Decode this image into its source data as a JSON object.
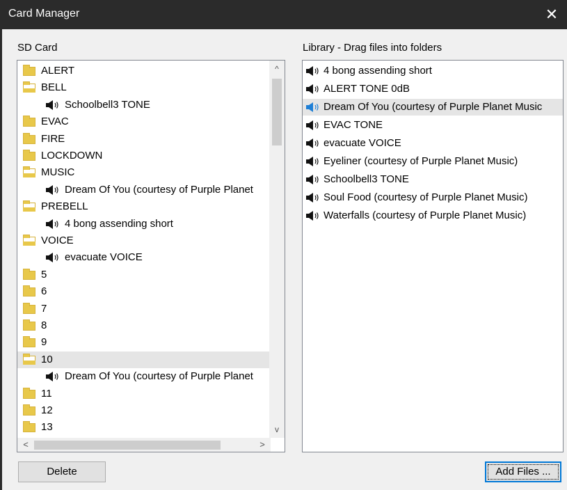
{
  "window": {
    "title": "Card Manager",
    "close_glyph": "✕"
  },
  "sd_card": {
    "label": "SD Card",
    "items": [
      {
        "type": "folder",
        "open": false,
        "label": "ALERT"
      },
      {
        "type": "folder",
        "open": true,
        "label": "BELL"
      },
      {
        "type": "file",
        "label": "Schoolbell3 TONE"
      },
      {
        "type": "folder",
        "open": false,
        "label": "EVAC"
      },
      {
        "type": "folder",
        "open": false,
        "label": "FIRE"
      },
      {
        "type": "folder",
        "open": false,
        "label": "LOCKDOWN"
      },
      {
        "type": "folder",
        "open": true,
        "label": "MUSIC"
      },
      {
        "type": "file",
        "label": "Dream Of You (courtesy of Purple Planet"
      },
      {
        "type": "folder",
        "open": true,
        "label": "PREBELL"
      },
      {
        "type": "file",
        "label": "4 bong assending short"
      },
      {
        "type": "folder",
        "open": true,
        "label": "VOICE"
      },
      {
        "type": "file",
        "label": "evacuate VOICE"
      },
      {
        "type": "folder",
        "open": false,
        "label": "5"
      },
      {
        "type": "folder",
        "open": false,
        "label": "6"
      },
      {
        "type": "folder",
        "open": false,
        "label": "7"
      },
      {
        "type": "folder",
        "open": false,
        "label": "8"
      },
      {
        "type": "folder",
        "open": false,
        "label": "9"
      },
      {
        "type": "folder",
        "open": true,
        "label": "10",
        "selected": true
      },
      {
        "type": "file",
        "label": "Dream Of You (courtesy of Purple Planet"
      },
      {
        "type": "folder",
        "open": false,
        "label": "11"
      },
      {
        "type": "folder",
        "open": false,
        "label": "12"
      },
      {
        "type": "folder",
        "open": false,
        "label": "13"
      }
    ],
    "scroll_up_glyph": "^",
    "scroll_down_glyph": "v",
    "scroll_left_glyph": "<",
    "scroll_right_glyph": ">"
  },
  "library": {
    "label": "Library - Drag files into folders",
    "items": [
      {
        "label": "4 bong assending short"
      },
      {
        "label": "ALERT TONE 0dB"
      },
      {
        "label": "Dream Of You (courtesy of Purple Planet Music",
        "selected": true
      },
      {
        "label": "EVAC TONE"
      },
      {
        "label": "evacuate VOICE"
      },
      {
        "label": "Eyeliner (courtesy of Purple Planet Music)"
      },
      {
        "label": "Schoolbell3 TONE"
      },
      {
        "label": "Soul Food (courtesy of Purple Planet Music)"
      },
      {
        "label": "Waterfalls (courtesy of Purple Planet Music)"
      }
    ]
  },
  "buttons": {
    "delete": "Delete",
    "add_files": "Add Files ..."
  },
  "colors": {
    "title_bar": "#2b2b2b",
    "folder": "#e8c84a",
    "selection": "#e5e5e5",
    "highlight_icon": "#1e7fd6"
  }
}
